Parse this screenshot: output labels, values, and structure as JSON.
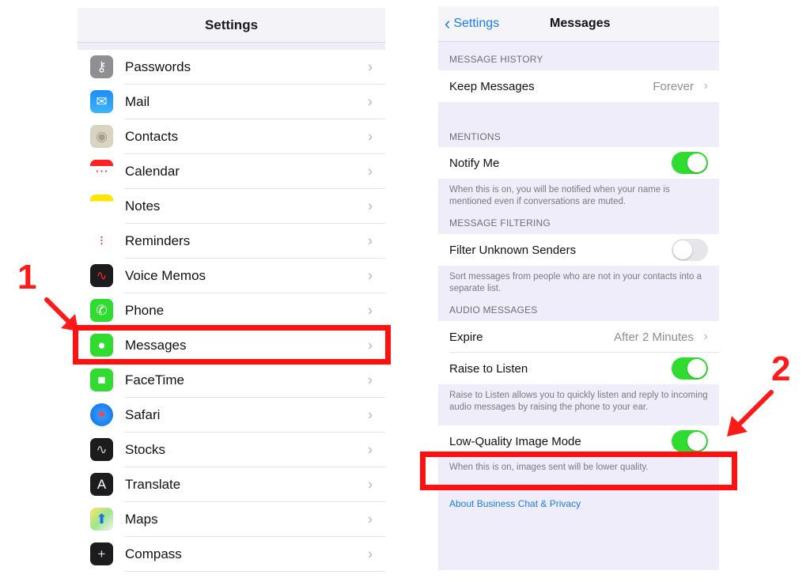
{
  "left_panel": {
    "title": "Settings",
    "items": [
      {
        "label": "Passwords",
        "icon": "key-icon"
      },
      {
        "label": "Mail",
        "icon": "mail-icon"
      },
      {
        "label": "Contacts",
        "icon": "contacts-icon"
      },
      {
        "label": "Calendar",
        "icon": "calendar-icon"
      },
      {
        "label": "Notes",
        "icon": "notes-icon"
      },
      {
        "label": "Reminders",
        "icon": "reminders-icon"
      },
      {
        "label": "Voice Memos",
        "icon": "voice-memos-icon"
      },
      {
        "label": "Phone",
        "icon": "phone-icon"
      },
      {
        "label": "Messages",
        "icon": "messages-icon"
      },
      {
        "label": "FaceTime",
        "icon": "facetime-icon"
      },
      {
        "label": "Safari",
        "icon": "safari-icon"
      },
      {
        "label": "Stocks",
        "icon": "stocks-icon"
      },
      {
        "label": "Translate",
        "icon": "translate-icon"
      },
      {
        "label": "Maps",
        "icon": "maps-icon"
      },
      {
        "label": "Compass",
        "icon": "compass-icon"
      }
    ],
    "chevron": "›"
  },
  "right_panel": {
    "back_label": "Settings",
    "back_chevron": "‹",
    "title": "Messages",
    "sections": {
      "history": {
        "header": "MESSAGE HISTORY",
        "keep_messages": {
          "label": "Keep Messages",
          "value": "Forever"
        }
      },
      "mentions": {
        "header": "MENTIONS",
        "notify_me": {
          "label": "Notify Me",
          "on": true
        },
        "footer": "When this is on, you will be notified when your name is mentioned even if conversations are muted."
      },
      "filtering": {
        "header": "MESSAGE FILTERING",
        "filter_unknown": {
          "label": "Filter Unknown Senders",
          "on": false
        },
        "footer": "Sort messages from people who are not in your contacts into a separate list."
      },
      "audio": {
        "header": "AUDIO MESSAGES",
        "expire": {
          "label": "Expire",
          "value": "After 2 Minutes"
        },
        "raise_to_listen": {
          "label": "Raise to Listen",
          "on": true
        },
        "footer": "Raise to Listen allows you to quickly listen and reply to incoming audio messages by raising the phone to your ear."
      },
      "low_quality": {
        "label": "Low-Quality Image Mode",
        "on": true,
        "footer": "When this is on, images sent will be lower quality."
      }
    },
    "link": "About Business Chat & Privacy",
    "chevron": "›"
  },
  "annotations": {
    "step1": "1",
    "step2": "2",
    "highlight_color": "#ff1111"
  },
  "colors": {
    "toggle_on": "#2fdc2f",
    "link_blue": "#1a7cf0"
  }
}
